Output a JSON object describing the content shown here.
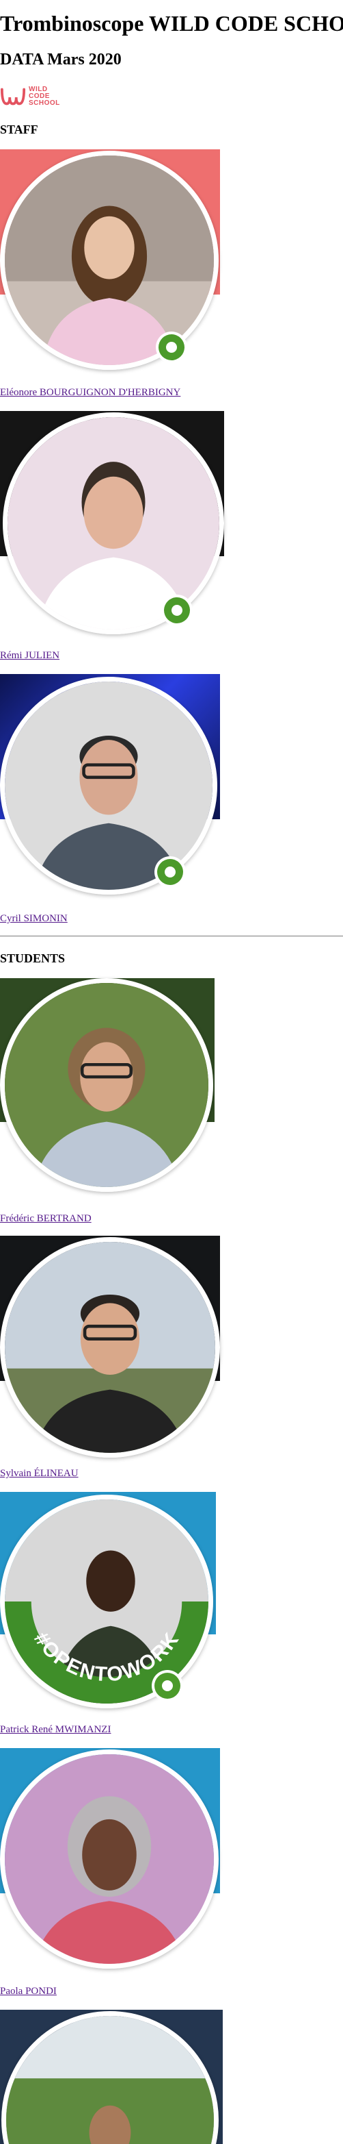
{
  "page": {
    "title": "Trombinoscope WILD CODE SCHOOL",
    "subtitle": "DATA Mars 2020"
  },
  "logo": {
    "lines": [
      "WILD",
      "CODE",
      "SCHOOL"
    ],
    "color": "#e3525f"
  },
  "staff": {
    "heading": "STAFF",
    "people": [
      {
        "name": "Eléonore BOURGUIGNON D'HERBIGNY",
        "background_color": "#ee6f6f",
        "status": "online",
        "badge_color": "#4b9a2a"
      },
      {
        "name": "Rémi JULIEN",
        "background_color": "#151515",
        "status": "online",
        "badge_color": "#4b9a2a"
      },
      {
        "name": "Cyril SIMONIN",
        "background_color": "#1c2bb8",
        "status": "online",
        "badge_color": "#4b9a2a"
      }
    ]
  },
  "students": {
    "heading": "STUDENTS",
    "people": [
      {
        "name": "Frédéric BERTRAND",
        "background_color": "#2f4a22"
      },
      {
        "name": "Sylvain ÉLINEAU",
        "background_color": "#141618"
      },
      {
        "name": "Patrick René MWIMANZI",
        "background_color": "#2596c9",
        "frame_text": "#OPENTOWORK",
        "frame_color": "#3f8e29"
      },
      {
        "name": "Paola PONDI",
        "background_color": "#2596c9"
      },
      {
        "name": "",
        "background_color": "#243650"
      }
    ]
  },
  "colors": {
    "link": "#551a8b",
    "divider": "#7a7a7a"
  }
}
